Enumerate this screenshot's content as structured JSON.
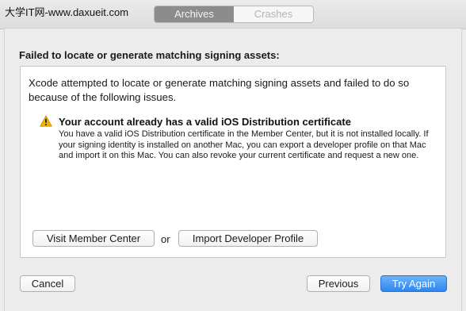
{
  "watermark": "大学IT网-www.daxueit.com",
  "tabs": {
    "archives": "Archives",
    "crashes": "Crashes"
  },
  "dialog": {
    "heading": "Failed to locate or generate matching signing assets:",
    "intro": "Xcode attempted to locate or generate matching signing assets and failed to do so because of the following issues.",
    "issue": {
      "icon": "warning-icon",
      "title": "Your account already has a valid iOS Distribution certificate",
      "body": "You have a valid iOS Distribution certificate in the Member Center, but it is not installed locally. If your signing identity is installed on another Mac, you can export a developer profile on that Mac and import it on this Mac. You can also revoke your current certificate and request a new one."
    },
    "actions": {
      "visit": "Visit Member Center",
      "or": "or",
      "import": "Import Developer Profile"
    },
    "footer": {
      "cancel": "Cancel",
      "previous": "Previous",
      "try_again": "Try Again"
    }
  },
  "colors": {
    "accent": "#2f86f0",
    "warning": "#f0b400",
    "segment_selected": "#8c8c8c"
  }
}
